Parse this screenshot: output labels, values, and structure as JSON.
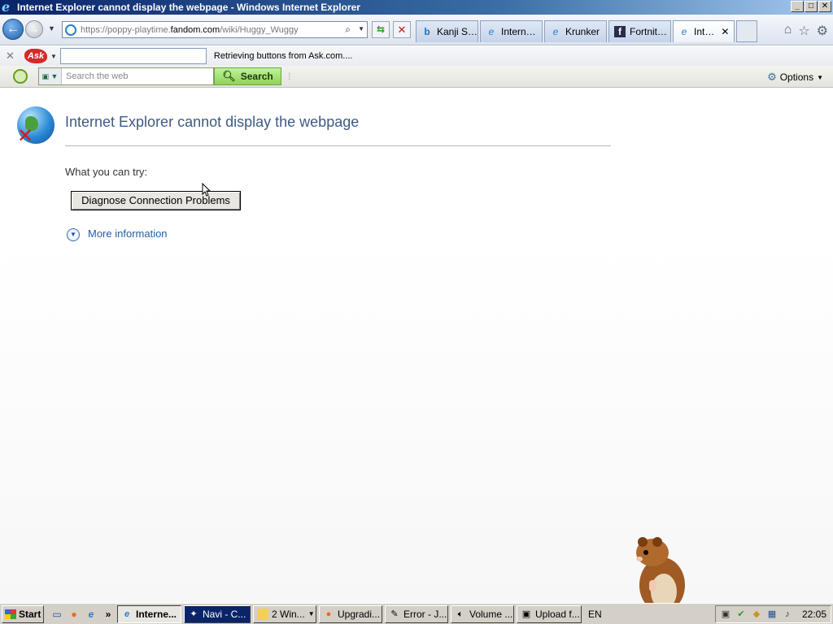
{
  "window": {
    "title": "Internet Explorer cannot display the webpage - Windows Internet Explorer",
    "controls": [
      "_",
      "□",
      "✕"
    ]
  },
  "navbar": {
    "address": {
      "url_prefix": "https://poppy-playtime.",
      "url_domain": "fandom.com",
      "url_path": "/wiki/Huggy_Wuggy"
    },
    "tabs": [
      {
        "label": "Kanji S…",
        "icon": "bing-icon"
      },
      {
        "label": "Intern…",
        "icon": "ie-icon"
      },
      {
        "label": "Krunker",
        "icon": "ie-icon"
      },
      {
        "label": "Fortnit…",
        "icon": "fandom-icon"
      },
      {
        "label": "Int…",
        "icon": "ie-icon",
        "active": true
      }
    ]
  },
  "askbar": {
    "logo": "Ask",
    "status": "Retrieving buttons from Ask.com...."
  },
  "searchbar": {
    "placeholder": "Search the web",
    "search_label": "Search",
    "options_label": "Options"
  },
  "page": {
    "title": "Internet Explorer cannot display the webpage",
    "try_label": "What you can try:",
    "diagnose_button": "Diagnose Connection Problems",
    "more_info": "More information"
  },
  "taskbar": {
    "start": "Start",
    "tasks": [
      {
        "label": "Interne...",
        "icon": "ie-icon",
        "active": true
      },
      {
        "label": "Navi - C...",
        "icon": "navi-icon"
      },
      {
        "label": "2 Win...",
        "icon": "folder-icon"
      },
      {
        "label": "Upgradi...",
        "icon": "firefox-icon"
      },
      {
        "label": "Error - J...",
        "icon": "doc-icon"
      },
      {
        "label": "Volume ...",
        "icon": "volume-icon"
      },
      {
        "label": "Upload f...",
        "icon": "window-icon"
      }
    ],
    "language": "EN",
    "clock": "22:05"
  }
}
